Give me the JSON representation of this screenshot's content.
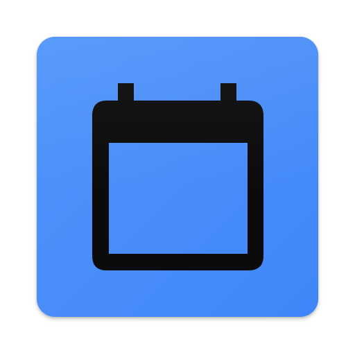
{
  "app_icon": {
    "icon": "calendar-icon",
    "tile_color": "#4a8ef9",
    "glyph_color": "#0b0b0b"
  }
}
